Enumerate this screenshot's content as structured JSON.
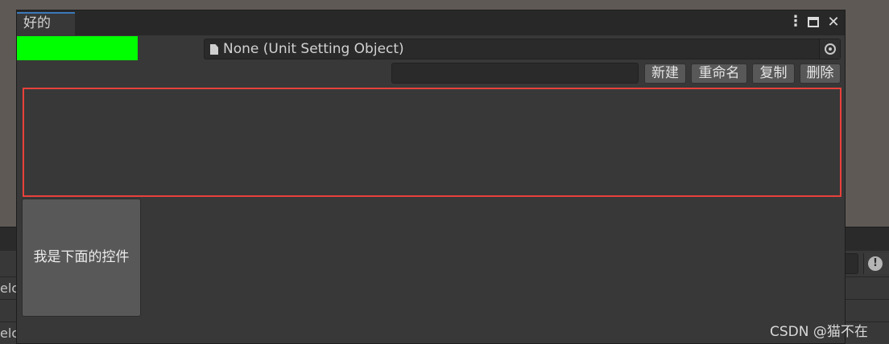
{
  "window": {
    "tab_title": "好的",
    "controls": {
      "menu_icon": "kebab-menu-icon",
      "maximize_icon": "maximize-icon",
      "close_icon": "close-icon"
    }
  },
  "color_bar": {
    "color": "#00ff00"
  },
  "object_field": {
    "value": "None (Unit Setting Object)",
    "icon": "document-icon",
    "picker_icon": "object-picker-icon"
  },
  "toolbar": {
    "name_input_value": "",
    "new_label": "新建",
    "rename_label": "重命名",
    "copy_label": "复制",
    "delete_label": "删除"
  },
  "highlight_box": {
    "border_color": "#e8413b"
  },
  "below_control": {
    "label": "我是下面的控件"
  },
  "background": {
    "line_text_1": "elc",
    "line_text_2": "elc"
  },
  "watermark": "CSDN @猫不在"
}
